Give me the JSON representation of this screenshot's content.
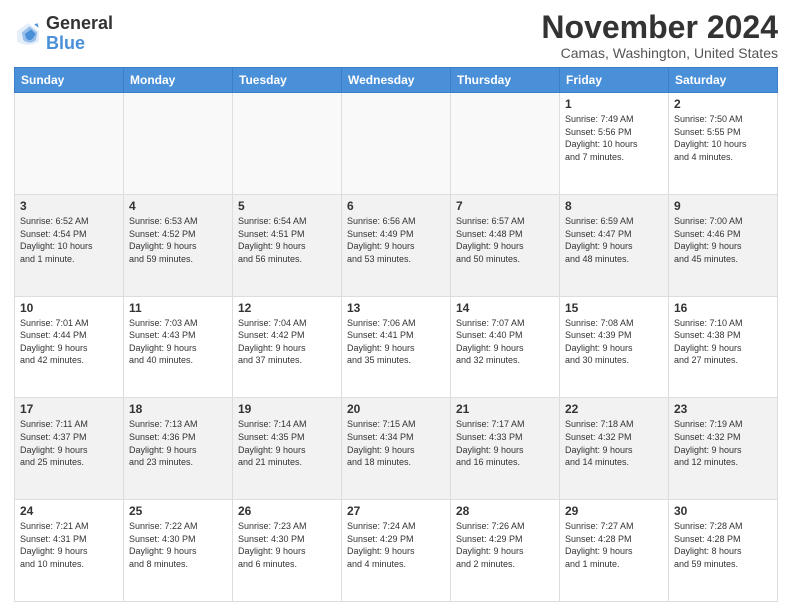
{
  "logo": {
    "text_general": "General",
    "text_blue": "Blue"
  },
  "header": {
    "title": "November 2024",
    "subtitle": "Camas, Washington, United States"
  },
  "weekdays": [
    "Sunday",
    "Monday",
    "Tuesday",
    "Wednesday",
    "Thursday",
    "Friday",
    "Saturday"
  ],
  "weeks": [
    [
      {
        "day": "",
        "info": ""
      },
      {
        "day": "",
        "info": ""
      },
      {
        "day": "",
        "info": ""
      },
      {
        "day": "",
        "info": ""
      },
      {
        "day": "",
        "info": ""
      },
      {
        "day": "1",
        "info": "Sunrise: 7:49 AM\nSunset: 5:56 PM\nDaylight: 10 hours\nand 7 minutes."
      },
      {
        "day": "2",
        "info": "Sunrise: 7:50 AM\nSunset: 5:55 PM\nDaylight: 10 hours\nand 4 minutes."
      }
    ],
    [
      {
        "day": "3",
        "info": "Sunrise: 6:52 AM\nSunset: 4:54 PM\nDaylight: 10 hours\nand 1 minute."
      },
      {
        "day": "4",
        "info": "Sunrise: 6:53 AM\nSunset: 4:52 PM\nDaylight: 9 hours\nand 59 minutes."
      },
      {
        "day": "5",
        "info": "Sunrise: 6:54 AM\nSunset: 4:51 PM\nDaylight: 9 hours\nand 56 minutes."
      },
      {
        "day": "6",
        "info": "Sunrise: 6:56 AM\nSunset: 4:49 PM\nDaylight: 9 hours\nand 53 minutes."
      },
      {
        "day": "7",
        "info": "Sunrise: 6:57 AM\nSunset: 4:48 PM\nDaylight: 9 hours\nand 50 minutes."
      },
      {
        "day": "8",
        "info": "Sunrise: 6:59 AM\nSunset: 4:47 PM\nDaylight: 9 hours\nand 48 minutes."
      },
      {
        "day": "9",
        "info": "Sunrise: 7:00 AM\nSunset: 4:46 PM\nDaylight: 9 hours\nand 45 minutes."
      }
    ],
    [
      {
        "day": "10",
        "info": "Sunrise: 7:01 AM\nSunset: 4:44 PM\nDaylight: 9 hours\nand 42 minutes."
      },
      {
        "day": "11",
        "info": "Sunrise: 7:03 AM\nSunset: 4:43 PM\nDaylight: 9 hours\nand 40 minutes."
      },
      {
        "day": "12",
        "info": "Sunrise: 7:04 AM\nSunset: 4:42 PM\nDaylight: 9 hours\nand 37 minutes."
      },
      {
        "day": "13",
        "info": "Sunrise: 7:06 AM\nSunset: 4:41 PM\nDaylight: 9 hours\nand 35 minutes."
      },
      {
        "day": "14",
        "info": "Sunrise: 7:07 AM\nSunset: 4:40 PM\nDaylight: 9 hours\nand 32 minutes."
      },
      {
        "day": "15",
        "info": "Sunrise: 7:08 AM\nSunset: 4:39 PM\nDaylight: 9 hours\nand 30 minutes."
      },
      {
        "day": "16",
        "info": "Sunrise: 7:10 AM\nSunset: 4:38 PM\nDaylight: 9 hours\nand 27 minutes."
      }
    ],
    [
      {
        "day": "17",
        "info": "Sunrise: 7:11 AM\nSunset: 4:37 PM\nDaylight: 9 hours\nand 25 minutes."
      },
      {
        "day": "18",
        "info": "Sunrise: 7:13 AM\nSunset: 4:36 PM\nDaylight: 9 hours\nand 23 minutes."
      },
      {
        "day": "19",
        "info": "Sunrise: 7:14 AM\nSunset: 4:35 PM\nDaylight: 9 hours\nand 21 minutes."
      },
      {
        "day": "20",
        "info": "Sunrise: 7:15 AM\nSunset: 4:34 PM\nDaylight: 9 hours\nand 18 minutes."
      },
      {
        "day": "21",
        "info": "Sunrise: 7:17 AM\nSunset: 4:33 PM\nDaylight: 9 hours\nand 16 minutes."
      },
      {
        "day": "22",
        "info": "Sunrise: 7:18 AM\nSunset: 4:32 PM\nDaylight: 9 hours\nand 14 minutes."
      },
      {
        "day": "23",
        "info": "Sunrise: 7:19 AM\nSunset: 4:32 PM\nDaylight: 9 hours\nand 12 minutes."
      }
    ],
    [
      {
        "day": "24",
        "info": "Sunrise: 7:21 AM\nSunset: 4:31 PM\nDaylight: 9 hours\nand 10 minutes."
      },
      {
        "day": "25",
        "info": "Sunrise: 7:22 AM\nSunset: 4:30 PM\nDaylight: 9 hours\nand 8 minutes."
      },
      {
        "day": "26",
        "info": "Sunrise: 7:23 AM\nSunset: 4:30 PM\nDaylight: 9 hours\nand 6 minutes."
      },
      {
        "day": "27",
        "info": "Sunrise: 7:24 AM\nSunset: 4:29 PM\nDaylight: 9 hours\nand 4 minutes."
      },
      {
        "day": "28",
        "info": "Sunrise: 7:26 AM\nSunset: 4:29 PM\nDaylight: 9 hours\nand 2 minutes."
      },
      {
        "day": "29",
        "info": "Sunrise: 7:27 AM\nSunset: 4:28 PM\nDaylight: 9 hours\nand 1 minute."
      },
      {
        "day": "30",
        "info": "Sunrise: 7:28 AM\nSunset: 4:28 PM\nDaylight: 8 hours\nand 59 minutes."
      }
    ]
  ]
}
